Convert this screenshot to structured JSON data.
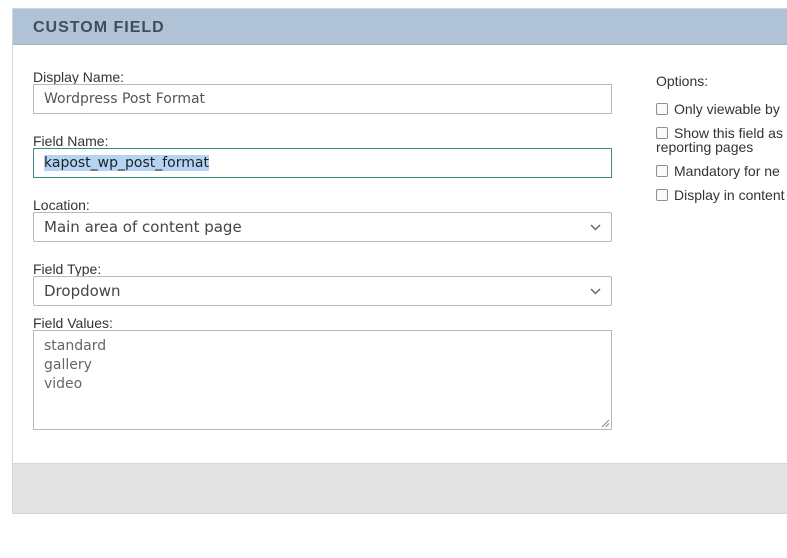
{
  "panel": {
    "title": "CUSTOM FIELD"
  },
  "form": {
    "display_name": {
      "label": "Display Name:",
      "value": "Wordpress Post Format"
    },
    "field_name": {
      "label": "Field Name:",
      "value": "kapost_wp_post_format"
    },
    "location": {
      "label": "Location:",
      "selected": "Main area of content page"
    },
    "field_type": {
      "label": "Field Type:",
      "selected": "Dropdown"
    },
    "field_values": {
      "label": "Field Values:",
      "lines": [
        "standard",
        "gallery",
        "video"
      ]
    }
  },
  "options": {
    "label": "Options:",
    "items": [
      {
        "line1": "Only viewable by",
        "line2": "",
        "checked": false
      },
      {
        "line1": "Show this field as",
        "line2": "reporting pages",
        "checked": false
      },
      {
        "line1": "Mandatory for ne",
        "line2": "",
        "checked": false
      },
      {
        "line1": "Display in content",
        "line2": "",
        "checked": false
      }
    ]
  },
  "colors": {
    "header_bg": "#b0c3d6",
    "focus_border": "#3d8a82",
    "selection": "#b5d3f5",
    "footer_bg": "#e4e4e4"
  }
}
